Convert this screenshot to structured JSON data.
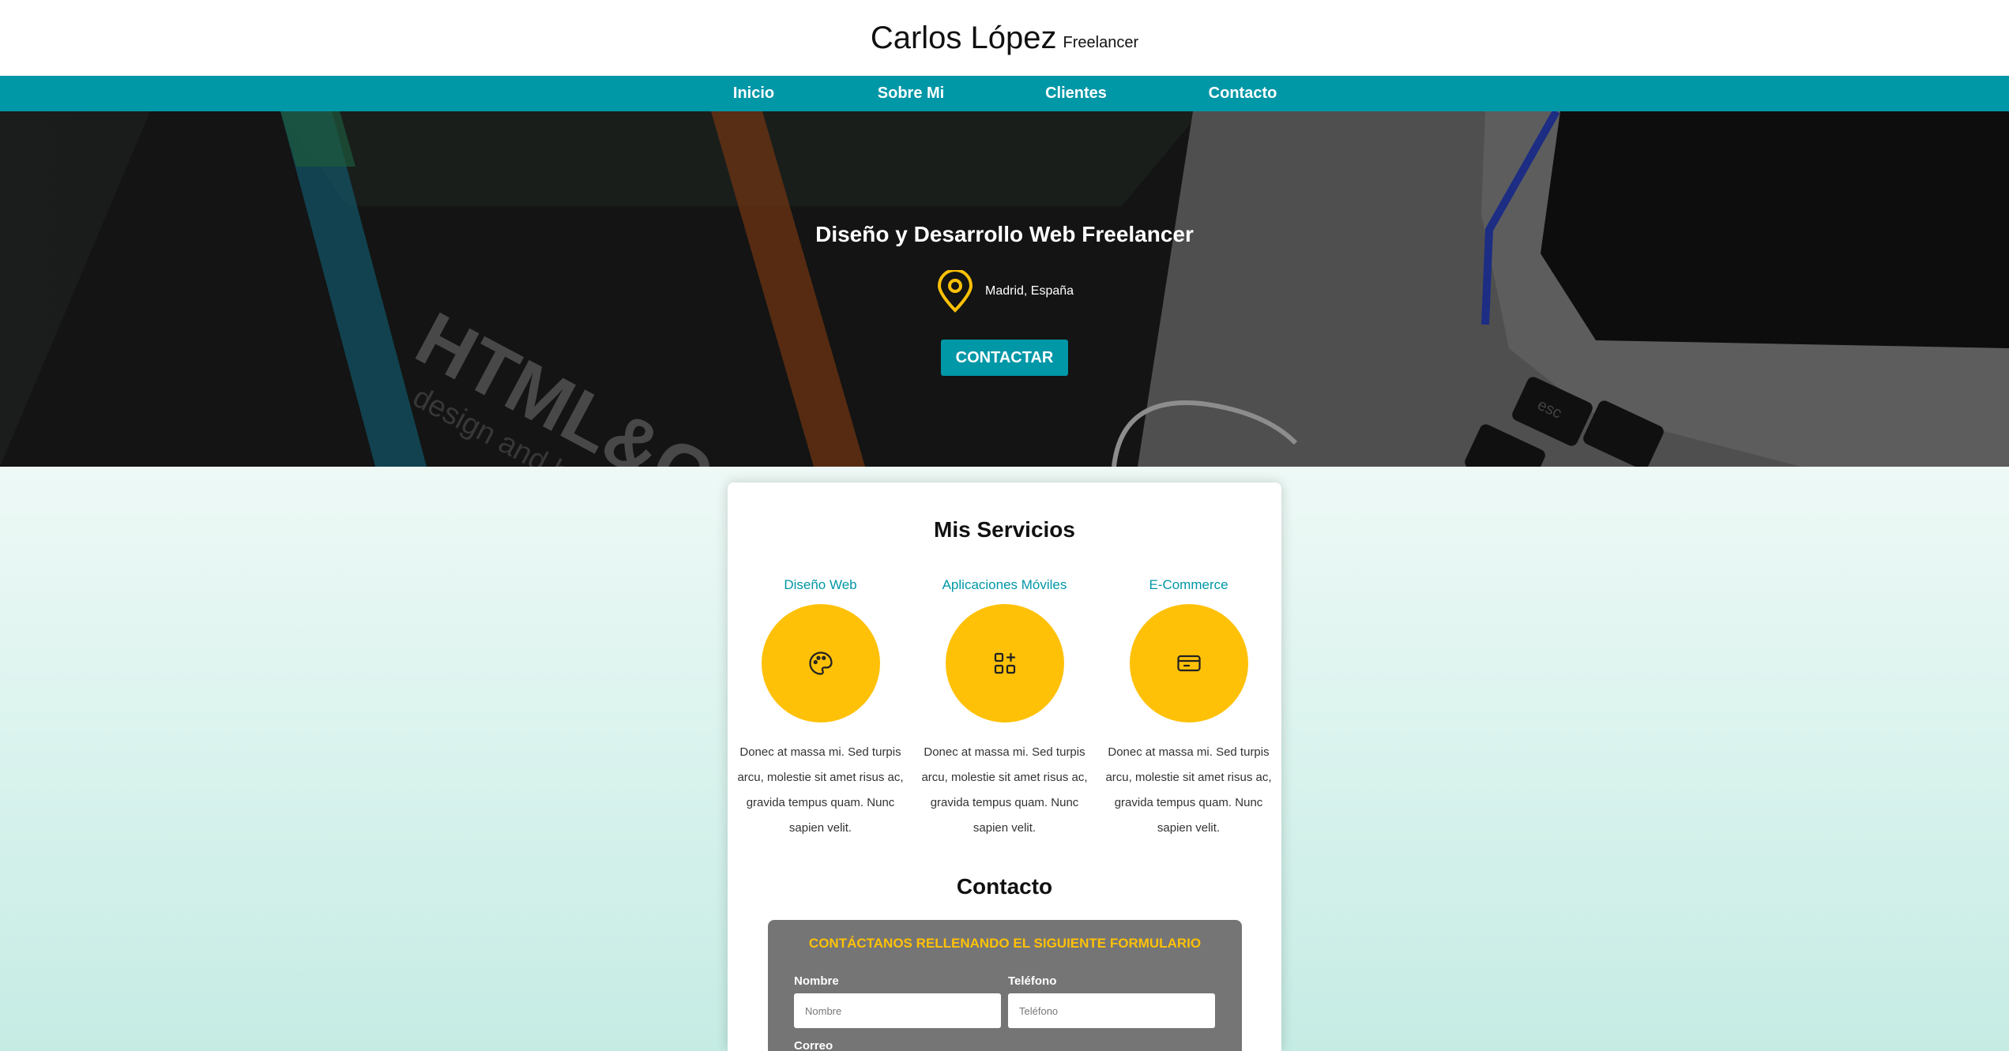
{
  "header": {
    "name": "Carlos López",
    "role": "Freelancer"
  },
  "nav": {
    "items": [
      {
        "label": "Inicio"
      },
      {
        "label": "Sobre Mi"
      },
      {
        "label": "Clientes"
      },
      {
        "label": "Contacto"
      }
    ]
  },
  "hero": {
    "title": "Diseño y Desarrollo Web Freelancer",
    "location": "Madrid, España",
    "location_icon": "map-pin-icon",
    "cta_label": "CONTACTAR",
    "background_art": {
      "line1": "HTML&CSS",
      "line2": "design and build websites",
      "key_esc": "esc"
    }
  },
  "services": {
    "title": "Mis Servicios",
    "items": [
      {
        "name": "Diseño Web",
        "icon": "palette-icon",
        "text": "Donec at massa mi. Sed turpis arcu, molestie sit amet risus ac, gravida tempus quam. Nunc sapien velit."
      },
      {
        "name": "Aplicaciones Móviles",
        "icon": "apps-grid-icon",
        "text": "Donec at massa mi. Sed turpis arcu, molestie sit amet risus ac, gravida tempus quam. Nunc sapien velit."
      },
      {
        "name": "E-Commerce",
        "icon": "credit-card-icon",
        "text": "Donec at massa mi. Sed turpis arcu, molestie sit amet risus ac, gravida tempus quam. Nunc sapien velit."
      }
    ]
  },
  "contact": {
    "title": "Contacto",
    "form_heading": "CONTÁCTANOS RELLENANDO EL SIGUIENTE FORMULARIO",
    "name_label": "Nombre",
    "name_placeholder": "Nombre",
    "phone_label": "Teléfono",
    "phone_placeholder": "Teléfono",
    "email_label": "Correo"
  },
  "colors": {
    "primary": "#0097a7",
    "accent": "#ffc107",
    "form_bg": "#757575"
  }
}
